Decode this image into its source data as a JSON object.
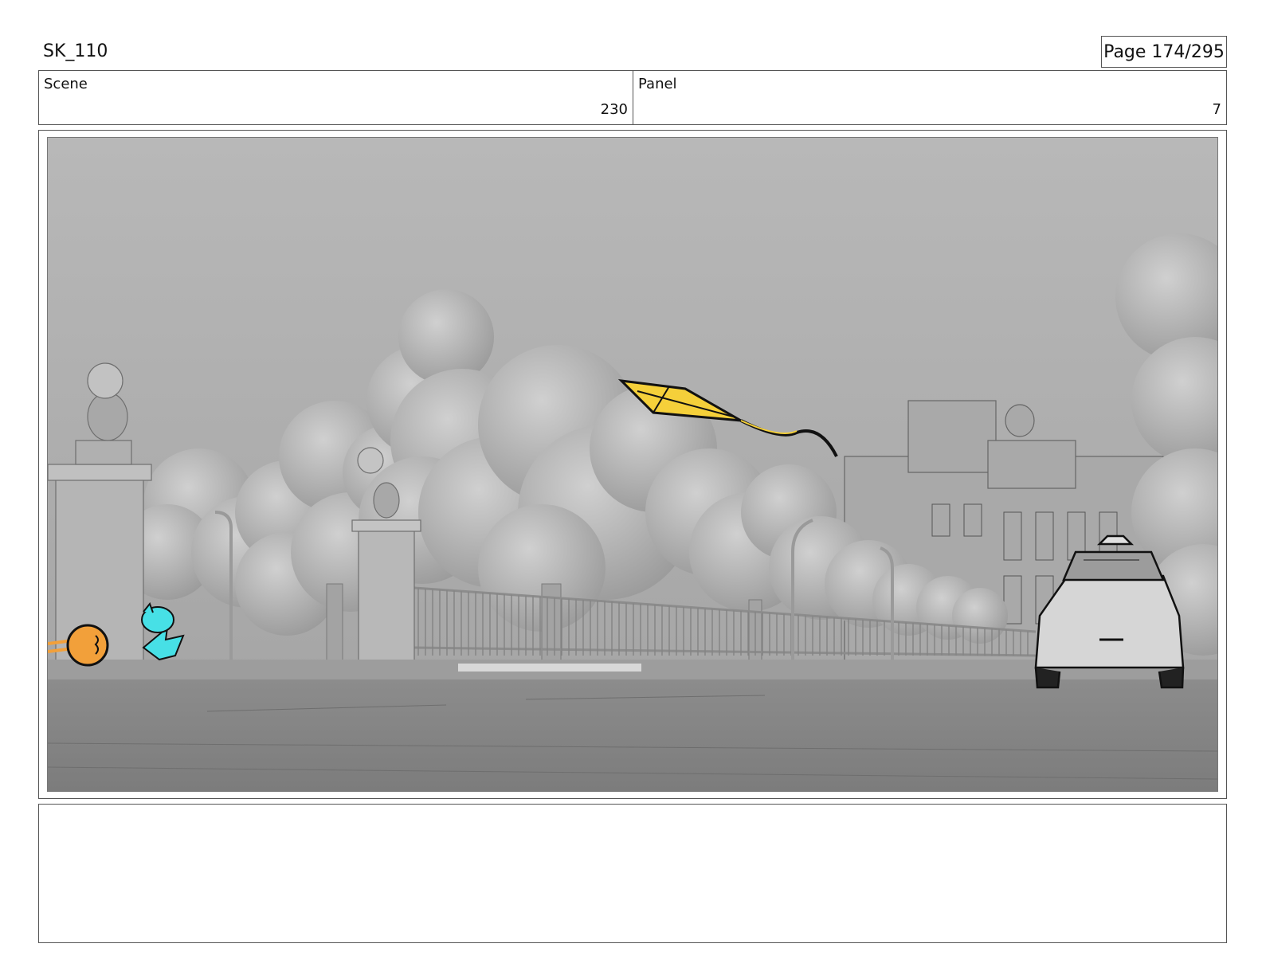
{
  "header": {
    "sequence": "SK_110",
    "page": "Page 174/295"
  },
  "info": {
    "scene_label": "Scene",
    "scene_value": "230",
    "panel_label": "Panel",
    "panel_value": "7"
  },
  "colors": {
    "kite": "#f5d03a",
    "orange_character": "#f2a03a",
    "cyan_character": "#47e0e6",
    "sky": "#b4b4b4",
    "road": "#8a8a8a"
  },
  "notes": {
    "text": ""
  }
}
